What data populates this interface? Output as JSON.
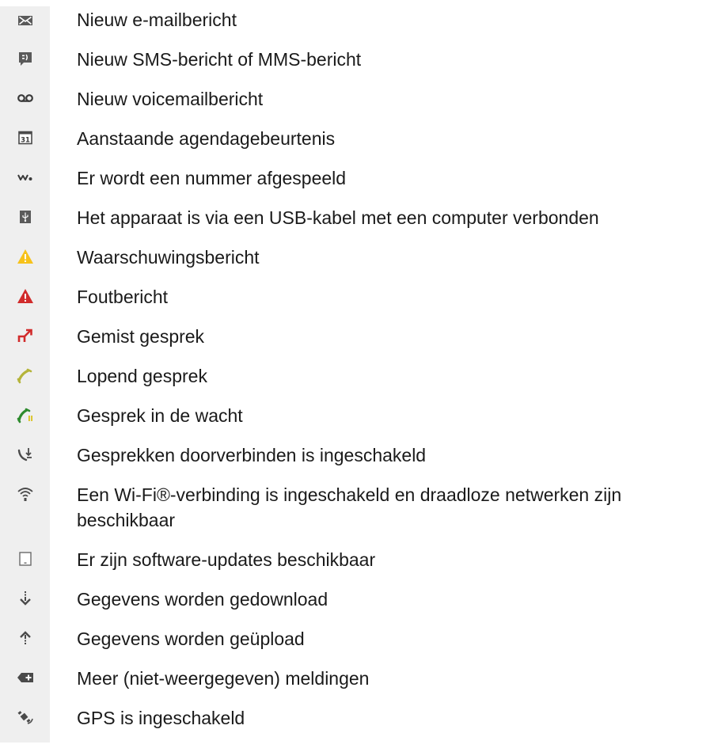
{
  "icons": [
    {
      "icon": "new-email-icon",
      "label": "Nieuw e-mailbericht"
    },
    {
      "icon": "sms-mms-icon",
      "label": "Nieuw SMS-bericht of MMS-bericht"
    },
    {
      "icon": "voicemail-icon",
      "label": "Nieuw voicemailbericht"
    },
    {
      "icon": "calendar-icon",
      "label": "Aanstaande agendagebeurtenis"
    },
    {
      "icon": "walkman-icon",
      "label": "Er wordt een nummer afgespeeld"
    },
    {
      "icon": "usb-icon",
      "label": "Het apparaat is via een USB-kabel met een computer verbonden"
    },
    {
      "icon": "warning-icon",
      "label": "Waarschuwingsbericht",
      "color": "#f7c21b"
    },
    {
      "icon": "error-icon",
      "label": "Foutbericht",
      "color": "#d12b2b"
    },
    {
      "icon": "missed-call-icon",
      "label": "Gemist gesprek",
      "color": "#d12b2b"
    },
    {
      "icon": "ongoing-call-icon",
      "label": "Lopend gesprek",
      "color": "#b5b43a"
    },
    {
      "icon": "call-on-hold-icon",
      "label": "Gesprek in de wacht",
      "color": "#2e8b2e"
    },
    {
      "icon": "call-forwarding-icon",
      "label": "Gesprekken doorverbinden is ingeschakeld"
    },
    {
      "icon": "wifi-icon",
      "label": "Een Wi-Fi®-verbinding is ingeschakeld en draadloze netwerken zijn beschikbaar"
    },
    {
      "icon": "software-update-icon",
      "label": "Er zijn software-updates beschikbaar"
    },
    {
      "icon": "download-icon",
      "label": "Gegevens worden gedownload"
    },
    {
      "icon": "upload-icon",
      "label": "Gegevens worden geüpload"
    },
    {
      "icon": "more-notifications-icon",
      "label": "Meer (niet-weergegeven) meldingen"
    },
    {
      "icon": "gps-icon",
      "label": "GPS is ingeschakeld"
    }
  ]
}
